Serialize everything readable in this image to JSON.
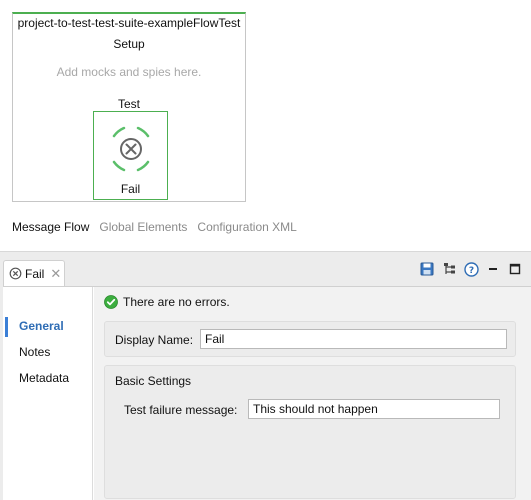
{
  "canvas": {
    "flow_title": "project-to-test-test-suite-exampleFlowTest",
    "setup_label": "Setup",
    "mocks_hint": "Add mocks and spies here.",
    "test_label": "Test",
    "fail_node_label": "Fail",
    "fail_node_icon": "fail-x-icon",
    "accent_color": "#4caf50"
  },
  "editor_tabs": [
    {
      "label": "Message Flow",
      "active": true
    },
    {
      "label": "Global Elements",
      "active": false
    },
    {
      "label": "Configuration XML",
      "active": false
    }
  ],
  "view": {
    "tab_label": "Fail",
    "tab_icon": "fail-x-icon",
    "toolbar_icons": [
      "save-icon",
      "tree-icon",
      "help-icon",
      "minimize-icon",
      "maximize-icon"
    ]
  },
  "nav": {
    "items": [
      {
        "label": "General",
        "active": true
      },
      {
        "label": "Notes",
        "active": false
      },
      {
        "label": "Metadata",
        "active": false
      }
    ]
  },
  "status": {
    "icon": "success-check-icon",
    "text": "There are no errors."
  },
  "general": {
    "display_name_label": "Display Name:",
    "display_name_value": "Fail",
    "basic_settings_title": "Basic Settings",
    "message_label": "Test failure message:",
    "message_value": "This should not happen"
  }
}
